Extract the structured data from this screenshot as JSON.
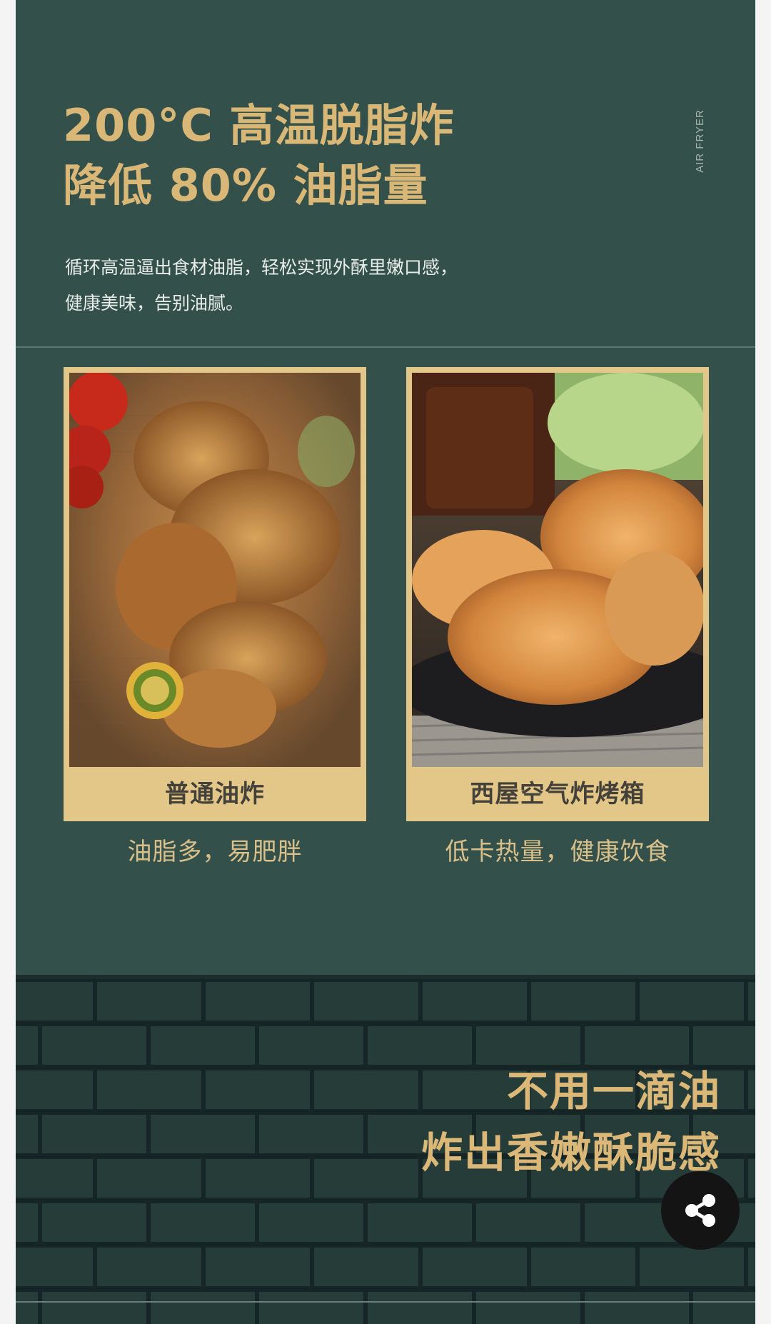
{
  "header": {
    "headline_line1": "200°C 高温脱脂炸",
    "headline_line2": "降低 80% 油脂量",
    "vertical_tag": "AIR FRYER",
    "description_line1": "循环高温逼出食材油脂，轻松实现外酥里嫩口感，",
    "description_line2": "健康美味，告别油腻。"
  },
  "comparison": [
    {
      "label": "普通油炸",
      "caption": "油脂多，易肥胖",
      "image_icon": "fried-chicken-photo"
    },
    {
      "label": "西屋空气炸烤箱",
      "caption": "低卡热量，健康饮食",
      "image_icon": "air-fried-chicken-photo"
    }
  ],
  "slogan": {
    "line1": "不用一滴油",
    "line2": "炸出香嫩酥脆感"
  },
  "share": {
    "icon": "share-icon"
  },
  "colors": {
    "panel": "#34504a",
    "gold": "#d9b777",
    "card": "#e3c788",
    "brick": "#243b37"
  }
}
